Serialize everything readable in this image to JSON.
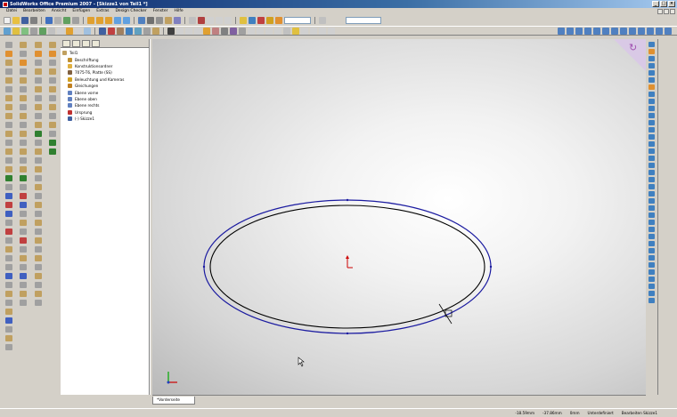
{
  "window": {
    "title": "SolidWorks Office Premium 2007 - [Skizze1 von Teil1 *]",
    "buttons": [
      "_",
      "□",
      "×"
    ]
  },
  "menubar": {
    "items": [
      "Datei",
      "Bearbeiten",
      "Ansicht",
      "Einfügen",
      "Extras",
      "Design Checker",
      "Fenster",
      "Hilfe"
    ]
  },
  "feature_tree": {
    "root": "Teil1",
    "items": [
      {
        "label": "Beschriftung",
        "icon": "annotations-icon",
        "color": "#c09030"
      },
      {
        "label": "Konstruktionsordner",
        "icon": "folder-icon",
        "color": "#e0b040"
      },
      {
        "label": "7075-T6, Platte (SS)",
        "icon": "material-icon",
        "color": "#806040"
      },
      {
        "label": "Beleuchtung und Kameras",
        "icon": "lights-icon",
        "color": "#d0a020"
      },
      {
        "label": "Gleichungen",
        "icon": "equations-icon",
        "color": "#c08020"
      },
      {
        "label": "Ebene vorne",
        "icon": "plane-icon",
        "color": "#6080c0"
      },
      {
        "label": "Ebene oben",
        "icon": "plane-icon",
        "color": "#6080c0"
      },
      {
        "label": "Ebene rechts",
        "icon": "plane-icon",
        "color": "#6080c0"
      },
      {
        "label": "Ursprung",
        "icon": "origin-icon",
        "color": "#c03030"
      },
      {
        "label": "(-) Skizze1",
        "icon": "sketch-icon",
        "color": "#4060a0"
      }
    ]
  },
  "viewport": {
    "tab_label": "*Vorderseite"
  },
  "status": {
    "x": "-18.59mm",
    "y": "-37.86mm",
    "z": "0mm",
    "definition": "Unterdefiniert",
    "mode": "Bearbeiten Skizze1"
  },
  "colors": {
    "selected_curve": "#1a1aa0",
    "sketch_curve": "#000000",
    "origin": "#cc0000"
  }
}
